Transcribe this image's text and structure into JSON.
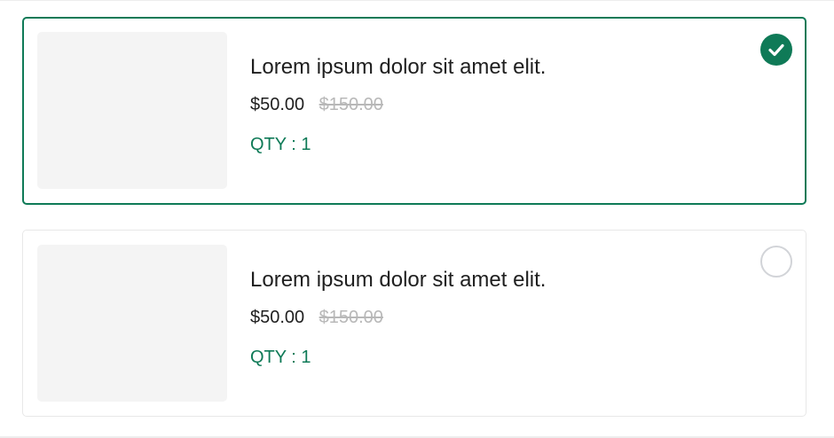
{
  "products": [
    {
      "title": "Lorem ipsum dolor sit amet elit.",
      "price": "$50.00",
      "old_price": "$150.00",
      "qty": "QTY : 1",
      "selected": true
    },
    {
      "title": "Lorem ipsum dolor sit amet elit.",
      "price": "$50.00",
      "old_price": "$150.00",
      "qty": "QTY : 1",
      "selected": false
    }
  ],
  "colors": {
    "accent": "#0f7a57",
    "strike_price": "#b8b8b8",
    "placeholder": "#f4f4f4",
    "unchecked_border": "#d2d4d8"
  },
  "icons": {
    "selected": "check-circle-icon",
    "unselected": "empty-radio-icon"
  }
}
